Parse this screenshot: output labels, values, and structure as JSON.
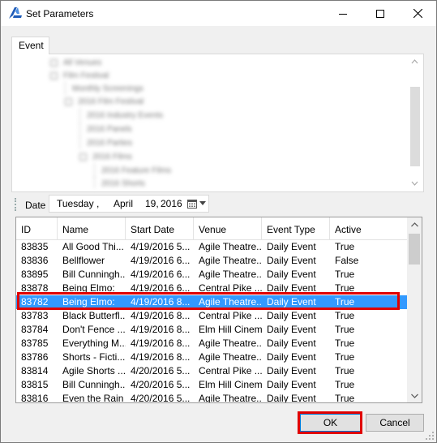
{
  "window": {
    "title": "Set Parameters",
    "icon": "app-logo-icon"
  },
  "tabs": [
    {
      "label": "Event",
      "active": true
    }
  ],
  "tree": {
    "blurred": true,
    "items": [
      {
        "label": "All Venues",
        "level": 1
      },
      {
        "label": "Film Festival",
        "level": 1
      },
      {
        "label": "Monthly Screenings",
        "level": 2
      },
      {
        "label": "2016 Film Festival",
        "level": 2
      },
      {
        "label": "2016 Industry Events",
        "level": 3
      },
      {
        "label": "2016 Panels",
        "level": 3
      },
      {
        "label": "2016 Parties",
        "level": 3
      },
      {
        "label": "2016 Films",
        "level": 3
      },
      {
        "label": "2016 Feature Films",
        "level": 4
      },
      {
        "label": "2016 Shorts",
        "level": 4
      }
    ]
  },
  "date": {
    "label": "Date",
    "weekday": "Tuesday",
    "sep": ",",
    "month": "April",
    "day": "19,",
    "year": "2016"
  },
  "grid": {
    "columns": [
      "ID",
      "Name",
      "Start Date",
      "Venue",
      "Event Type",
      "Active"
    ],
    "selected_index": 4,
    "rows": [
      [
        "83835",
        "All Good Thi...",
        "4/19/2016 5...",
        "Agile Theatre...",
        "Daily Event",
        "True"
      ],
      [
        "83836",
        "Bellflower",
        "4/19/2016 6...",
        "Agile Theatre...",
        "Daily Event",
        "False"
      ],
      [
        "83895",
        "Bill Cunningh...",
        "4/19/2016 6...",
        "Agile Theatre...",
        "Daily Event",
        "True"
      ],
      [
        "83878",
        "Being Elmo:",
        "4/19/2016 6...",
        "Central Pike ...",
        "Daily Event",
        "True"
      ],
      [
        "83782",
        "Being Elmo:",
        "4/19/2016 8...",
        "Agile Theatre...",
        "Daily Event",
        "True"
      ],
      [
        "83783",
        "Black Butterfl...",
        "4/19/2016 8...",
        "Central Pike ...",
        "Daily Event",
        "True"
      ],
      [
        "83784",
        "Don't Fence ...",
        "4/19/2016 8...",
        "Elm Hill Cinema",
        "Daily Event",
        "True"
      ],
      [
        "83785",
        "Everything M...",
        "4/19/2016 8...",
        "Agile Theatre...",
        "Daily Event",
        "True"
      ],
      [
        "83786",
        "Shorts - Ficti...",
        "4/19/2016 8...",
        "Agile Theatre...",
        "Daily Event",
        "True"
      ],
      [
        "83814",
        "Agile Shorts ...",
        "4/20/2016 5...",
        "Central Pike ...",
        "Daily Event",
        "True"
      ],
      [
        "83815",
        "Bill Cunningh...",
        "4/20/2016 5...",
        "Elm Hill Cinema",
        "Daily Event",
        "True"
      ],
      [
        "83816",
        "Even the Rain",
        "4/20/2016 5...",
        "Agile Theatre...",
        "Daily Event",
        "True"
      ]
    ]
  },
  "buttons": {
    "ok": "OK",
    "cancel": "Cancel"
  },
  "colors": {
    "selection": "#3399ff",
    "highlight_outline": "#e00000",
    "app_icon": "#1e5bb8"
  }
}
